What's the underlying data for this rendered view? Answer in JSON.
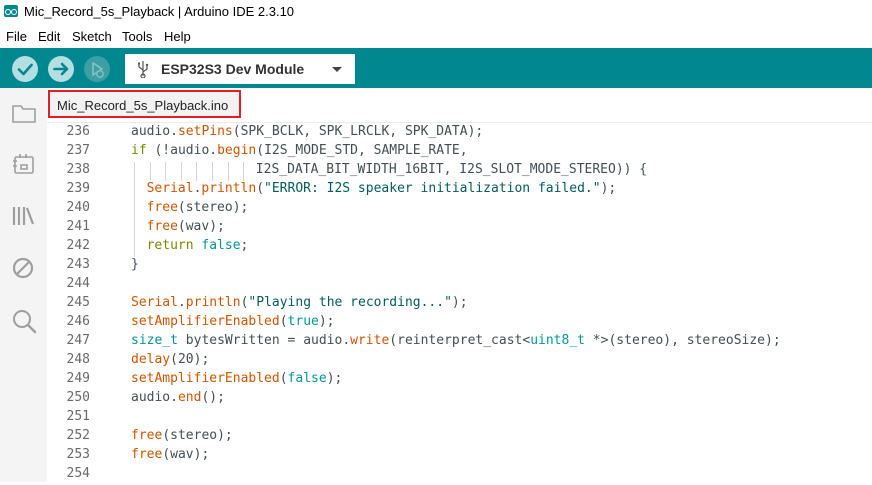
{
  "window": {
    "title": "Mic_Record_5s_Playback | Arduino IDE 2.3.10"
  },
  "menu": [
    "File",
    "Edit",
    "Sketch",
    "Tools",
    "Help"
  ],
  "toolbar": {
    "verify_label": "Verify",
    "upload_label": "Upload",
    "debug_label": "Start Debugging",
    "board": "ESP32S3 Dev Module"
  },
  "sidebar": [
    "sketchbook-icon",
    "boards-manager-icon",
    "library-manager-icon",
    "debug-icon",
    "search-icon"
  ],
  "tab": {
    "filename": "Mic_Record_5s_Playback.ino"
  },
  "colors": {
    "teal": "#00878f",
    "highlight": "#e01f26"
  },
  "editor": {
    "lines": [
      {
        "num": "236",
        "indent": 1,
        "tokens": [
          [
            "audio.",
            "p"
          ],
          [
            "setPins",
            "fn"
          ],
          [
            "(SPK_BCLK, SPK_LRCLK, SPK_DATA);",
            "p"
          ]
        ]
      },
      {
        "num": "237",
        "indent": 1,
        "tokens": [
          [
            "if",
            "ctl"
          ],
          [
            " (!audio.",
            "p"
          ],
          [
            "begin",
            "fn"
          ],
          [
            "(I2S_MODE_STD, SAMPLE_RATE,",
            "p"
          ]
        ]
      },
      {
        "num": "238",
        "indent": 9,
        "tokens": [
          [
            "I2S_DATA_BIT_WIDTH_16BIT, I2S_SLOT_MODE_STEREO)) {",
            "p"
          ]
        ]
      },
      {
        "num": "239",
        "indent": 2,
        "tokens": [
          [
            "Serial",
            "fn"
          ],
          [
            ".",
            "p"
          ],
          [
            "println",
            "fn"
          ],
          [
            "(",
            "p"
          ],
          [
            "\"ERROR: I2S speaker initialization failed.\"",
            "str"
          ],
          [
            ");",
            "p"
          ]
        ]
      },
      {
        "num": "240",
        "indent": 2,
        "tokens": [
          [
            "free",
            "fn"
          ],
          [
            "(stereo);",
            "p"
          ]
        ]
      },
      {
        "num": "241",
        "indent": 2,
        "tokens": [
          [
            "free",
            "fn"
          ],
          [
            "(wav);",
            "p"
          ]
        ]
      },
      {
        "num": "242",
        "indent": 2,
        "tokens": [
          [
            "return",
            "ctl"
          ],
          [
            " ",
            "p"
          ],
          [
            "false",
            "lit"
          ],
          [
            ";",
            "p"
          ]
        ]
      },
      {
        "num": "243",
        "indent": 1,
        "tokens": [
          [
            "}",
            "p"
          ]
        ]
      },
      {
        "num": "244",
        "indent": 0,
        "tokens": []
      },
      {
        "num": "245",
        "indent": 1,
        "tokens": [
          [
            "Serial",
            "fn"
          ],
          [
            ".",
            "p"
          ],
          [
            "println",
            "fn"
          ],
          [
            "(",
            "p"
          ],
          [
            "\"Playing the recording...\"",
            "str"
          ],
          [
            ");",
            "p"
          ]
        ]
      },
      {
        "num": "246",
        "indent": 1,
        "tokens": [
          [
            "setAmplifierEnabled",
            "fn"
          ],
          [
            "(",
            "p"
          ],
          [
            "true",
            "lit"
          ],
          [
            ");",
            "p"
          ]
        ]
      },
      {
        "num": "247",
        "indent": 1,
        "tokens": [
          [
            "size_t",
            "type"
          ],
          [
            " bytesWritten = audio.",
            "p"
          ],
          [
            "write",
            "fn"
          ],
          [
            "(",
            "p"
          ],
          [
            "reinterpret_cast",
            "p"
          ],
          [
            "<",
            "p"
          ],
          [
            "uint8_t",
            "type"
          ],
          [
            " *>(stereo), stereoSize);",
            "p"
          ]
        ]
      },
      {
        "num": "248",
        "indent": 1,
        "tokens": [
          [
            "delay",
            "fn"
          ],
          [
            "(20);",
            "p"
          ]
        ]
      },
      {
        "num": "249",
        "indent": 1,
        "tokens": [
          [
            "setAmplifierEnabled",
            "fn"
          ],
          [
            "(",
            "p"
          ],
          [
            "false",
            "lit"
          ],
          [
            ");",
            "p"
          ]
        ]
      },
      {
        "num": "250",
        "indent": 1,
        "tokens": [
          [
            "audio.",
            "p"
          ],
          [
            "end",
            "fn"
          ],
          [
            "();",
            "p"
          ]
        ]
      },
      {
        "num": "251",
        "indent": 0,
        "tokens": []
      },
      {
        "num": "252",
        "indent": 1,
        "tokens": [
          [
            "free",
            "fn"
          ],
          [
            "(stereo);",
            "p"
          ]
        ]
      },
      {
        "num": "253",
        "indent": 1,
        "tokens": [
          [
            "free",
            "fn"
          ],
          [
            "(wav);",
            "p"
          ]
        ]
      },
      {
        "num": "254",
        "indent": 0,
        "tokens": []
      }
    ]
  }
}
